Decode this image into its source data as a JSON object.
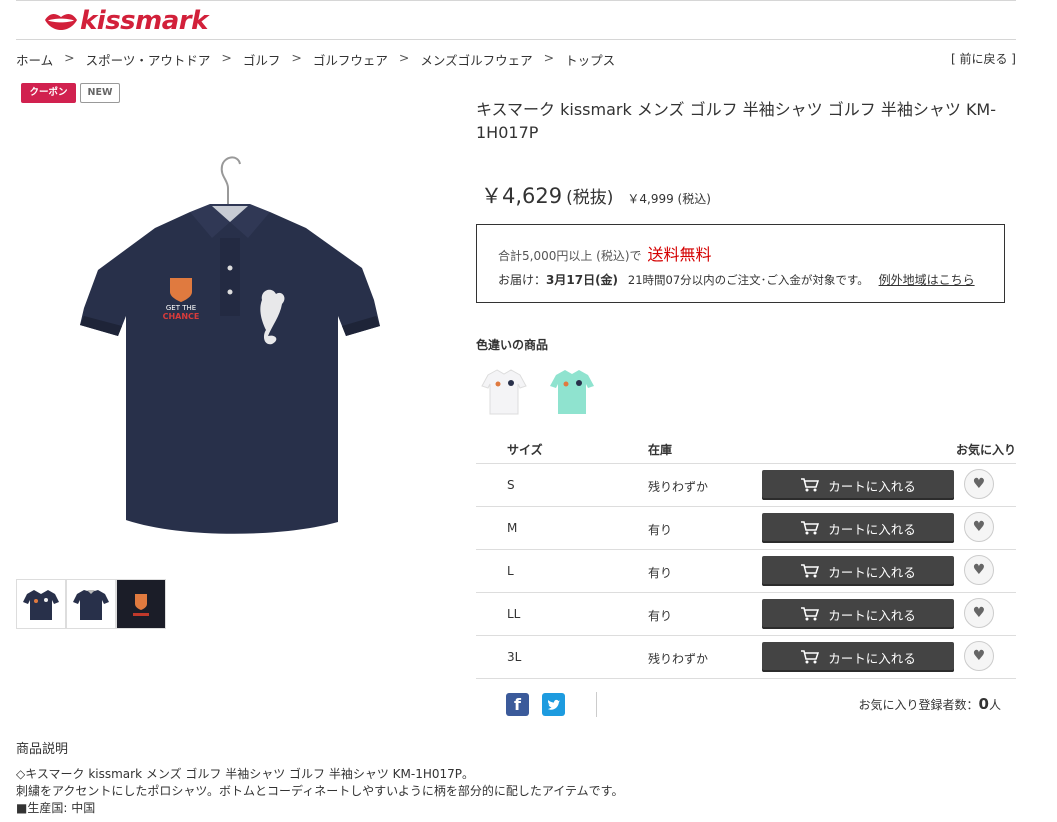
{
  "header": {
    "logo_text": "kissmark",
    "brand_color": "#d2203a"
  },
  "breadcrumb": [
    "ホーム",
    "スポーツ・アウトドア",
    "ゴルフ",
    "ゴルフウェア",
    "メンズゴルフウェア",
    "トップス"
  ],
  "back_link": "[ 前に戻る ]",
  "badges": {
    "coupon": "クーポン",
    "new": "NEW"
  },
  "product": {
    "title": "キスマーク kissmark メンズ ゴルフ 半袖シャツ ゴルフ 半袖シャツ KM-1H017P",
    "price": "￥4,629",
    "price_tax_label": "(税抜)",
    "price_incl": "￥4,999 (税込)",
    "shirt_print_1": "GET THE",
    "shirt_print_2": "CHANCE"
  },
  "shipping": {
    "condition": "合計5,000円以上 (税込)で",
    "free_label": "送料無料",
    "delivery_prefix": "お届け：",
    "delivery_date": "3月17日(金)",
    "delivery_note": "21時間07分以内のご注文･ご入金が対象です。",
    "exception_link": "例外地域はこちら",
    "free_color": "#d40000"
  },
  "variants": {
    "title": "色違いの商品",
    "colors": [
      "#f4f4f6",
      "#8fe3cf"
    ]
  },
  "size_table": {
    "headers": {
      "size": "サイズ",
      "stock": "在庫",
      "favorite": "お気に入り"
    },
    "cart_label": "カートに入れる",
    "rows": [
      {
        "size": "S",
        "stock": "残りわずか"
      },
      {
        "size": "M",
        "stock": "有り"
      },
      {
        "size": "L",
        "stock": "有り"
      },
      {
        "size": "LL",
        "stock": "有り"
      },
      {
        "size": "3L",
        "stock": "残りわずか"
      }
    ]
  },
  "favorites": {
    "label": "お気に入り登録者数：",
    "count": "0",
    "unit": "人"
  },
  "description": {
    "title": "商品説明",
    "lines": [
      "◇キスマーク kissmark メンズ ゴルフ 半袖シャツ ゴルフ 半袖シャツ KM-1H017P。",
      "刺繍をアクセントにしたポロシャツ。ボトムとコーディネートしやすいように柄を部分的に配したアイテムです。",
      "■生産国: 中国"
    ]
  }
}
